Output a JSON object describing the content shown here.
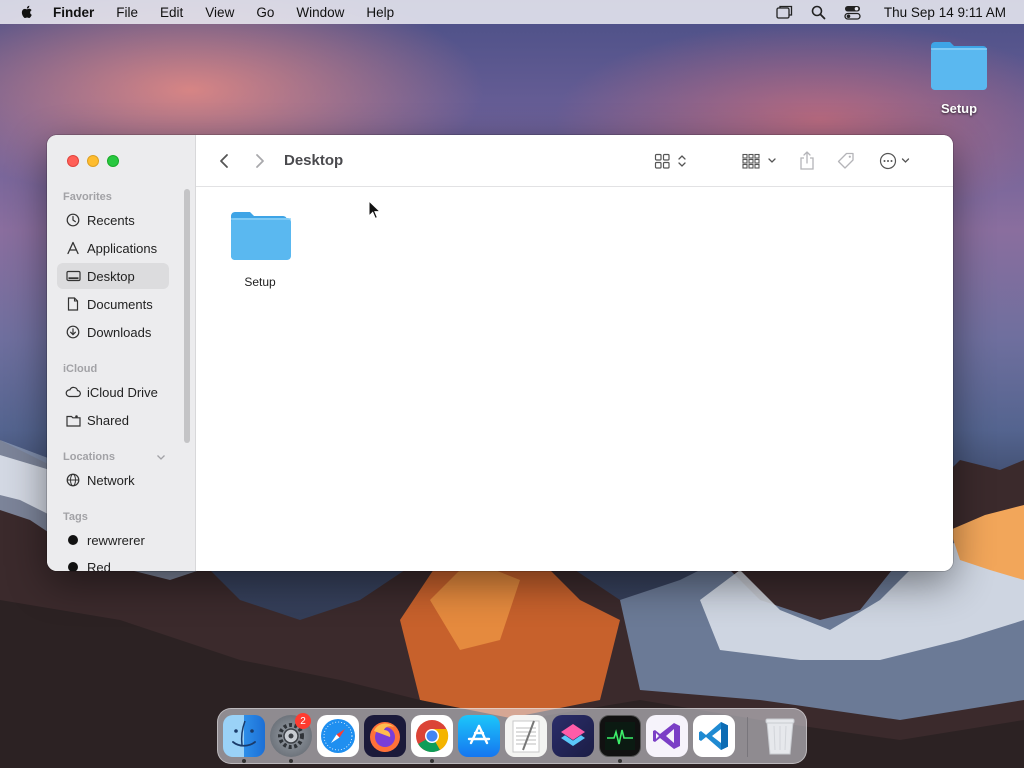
{
  "menubar": {
    "app_name": "Finder",
    "items": [
      "File",
      "Edit",
      "View",
      "Go",
      "Window",
      "Help"
    ],
    "clock": "Thu Sep 14  9:11 AM"
  },
  "desktop": {
    "icons": [
      {
        "label": "Setup",
        "icon": "folder-icon"
      }
    ]
  },
  "window": {
    "title": "Desktop",
    "sidebar": {
      "favorites_title": "Favorites",
      "favorites": [
        {
          "label": "Recents",
          "icon": "clock-icon"
        },
        {
          "label": "Applications",
          "icon": "applications-icon"
        },
        {
          "label": "Desktop",
          "icon": "desktop-icon",
          "selected": true
        },
        {
          "label": "Documents",
          "icon": "document-icon"
        },
        {
          "label": "Downloads",
          "icon": "download-icon"
        }
      ],
      "icloud_title": "iCloud",
      "icloud": [
        {
          "label": "iCloud Drive",
          "icon": "cloud-icon"
        },
        {
          "label": "Shared",
          "icon": "shared-folder-icon"
        }
      ],
      "locations_title": "Locations",
      "locations": [
        {
          "label": "Network",
          "icon": "globe-icon"
        }
      ],
      "tags_title": "Tags",
      "tags": [
        {
          "label": "rewwrerer",
          "color": "#111111"
        },
        {
          "label": "Red",
          "color": "#111111"
        }
      ]
    },
    "files": [
      {
        "name": "Setup",
        "icon": "folder-icon"
      }
    ]
  },
  "dock": {
    "apps": [
      {
        "name": "Finder",
        "icon": "finder-icon",
        "running": true
      },
      {
        "name": "System Settings",
        "icon": "settings-gear-icon",
        "badge": "2",
        "running": true
      },
      {
        "name": "Safari",
        "icon": "safari-compass-icon"
      },
      {
        "name": "Firefox",
        "icon": "firefox-icon"
      },
      {
        "name": "Chrome",
        "icon": "chrome-icon",
        "running": true
      },
      {
        "name": "App Store",
        "icon": "app-store-icon"
      },
      {
        "name": "TextEdit",
        "icon": "textedit-icon"
      },
      {
        "name": "Shortcuts",
        "icon": "shortcuts-icon"
      },
      {
        "name": "Activity Monitor",
        "icon": "activity-monitor-icon",
        "running": true
      },
      {
        "name": "Visual Studio",
        "icon": "visual-studio-icon"
      },
      {
        "name": "VS Code",
        "icon": "vscode-icon"
      },
      {
        "name": "Trash",
        "icon": "trash-icon"
      }
    ]
  },
  "colors": {
    "folder": "#5ab8f0",
    "selection": "#dcdcde",
    "close": "#ff5f57",
    "minimize": "#febc2e",
    "maximize": "#28c840"
  }
}
